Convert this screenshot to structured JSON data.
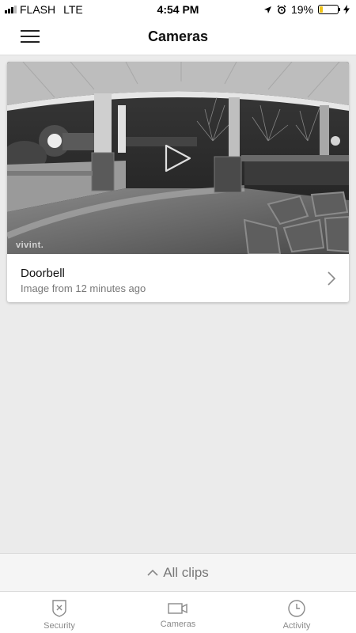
{
  "status_bar": {
    "carrier": "FLASH",
    "network": "LTE",
    "time": "4:54 PM",
    "battery_percent": "19%",
    "battery_level": 0.19,
    "battery_color": "#f0c419"
  },
  "header": {
    "title": "Cameras",
    "menu_icon": "hamburger-menu-icon"
  },
  "camera_card": {
    "name": "Doorbell",
    "subtitle": "Image from 12 minutes ago",
    "watermark": "vivint.",
    "play_icon": "play-icon",
    "chevron_icon": "chevron-right-icon"
  },
  "all_clips": {
    "label": "All clips",
    "icon": "chevron-up-icon"
  },
  "tabs": [
    {
      "label": "Security",
      "icon": "shield-icon"
    },
    {
      "label": "Cameras",
      "icon": "video-camera-icon"
    },
    {
      "label": "Activity",
      "icon": "clock-icon"
    }
  ]
}
